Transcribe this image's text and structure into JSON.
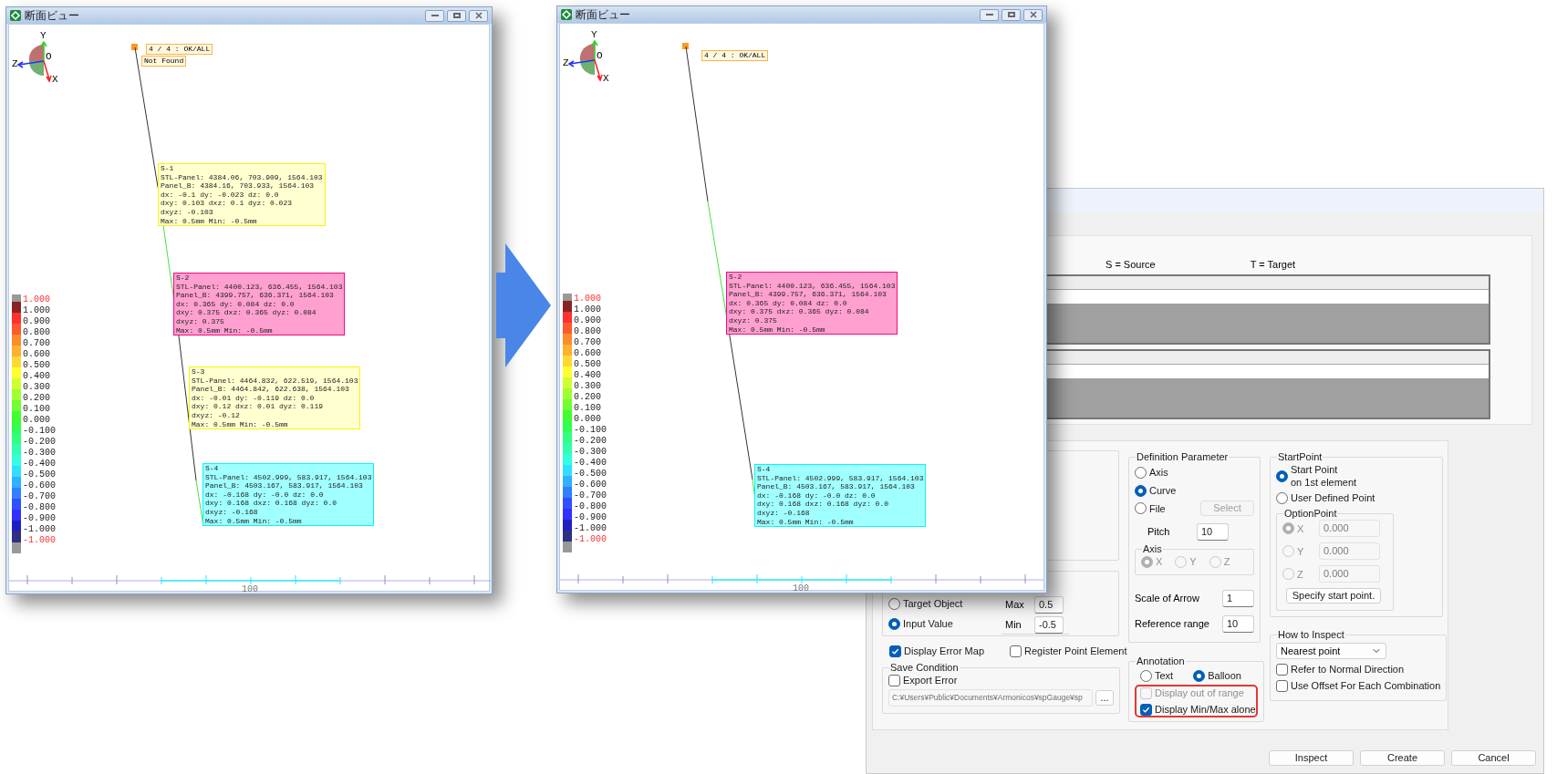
{
  "windows": [
    {
      "title": "断面ビュー",
      "axes": {
        "y": "Y",
        "z": "Z",
        "origin": "O",
        "x": "X"
      },
      "summary": "4 / 4 : OK/ALL",
      "notes": [
        "Not Found"
      ],
      "balloons": [
        {
          "color": "#ffffd0",
          "lines": [
            "S-1",
            "STL-Panel: 4384.06, 703.909, 1564.103",
            "Panel_B: 4384.16, 703.933, 1564.103",
            "dx: -0.1 dy: -0.023 dz: 0.0",
            "dxy: 0.103 dxz: 0.1 dyz: 0.023",
            "dxyz: -0.103",
            "Max: 0.5mm Min: -0.5mm"
          ]
        },
        {
          "color": "#ffa0d0",
          "lines": [
            "S-2",
            "STL-Panel: 4400.123, 636.455, 1564.103",
            "Panel_B: 4399.757, 636.371, 1564.103",
            "dx: 0.365 dy: 0.084 dz: 0.0",
            "dxy: 0.375 dxz: 0.365 dyz: 0.084",
            "dxyz: 0.375",
            "Max: 0.5mm Min: -0.5mm"
          ]
        },
        {
          "color": "#ffffd0",
          "lines": [
            "S-3",
            "STL-Panel: 4464.832, 622.519, 1564.103",
            "Panel_B: 4464.842, 622.638, 1564.103",
            "dx: -0.01 dy: -0.119 dz: 0.0",
            "dxy: 0.12 dxz: 0.01 dyz: 0.119",
            "dxyz: -0.12",
            "Max: 0.5mm Min: -0.5mm"
          ]
        },
        {
          "color": "#a0ffff",
          "lines": [
            "S-4",
            "STL-Panel: 4502.999, 583.917, 1564.103",
            "Panel_B: 4503.167, 583.917, 1564.103",
            "dx: -0.168 dy: -0.0 dz: 0.0",
            "dxy: 0.168 dxz: 0.168 dyz: 0.0",
            "dxyz: -0.168",
            "Max: 0.5mm Min: -0.5mm"
          ]
        }
      ],
      "legend": [
        {
          "value": "1.000",
          "kind": "limit"
        },
        {
          "value": "1.000",
          "kind": "step"
        },
        {
          "value": "0.900",
          "kind": "step"
        },
        {
          "value": "0.800",
          "kind": "step"
        },
        {
          "value": "0.700",
          "kind": "step"
        },
        {
          "value": "0.600",
          "kind": "step"
        },
        {
          "value": "0.500",
          "kind": "step"
        },
        {
          "value": "0.400",
          "kind": "step"
        },
        {
          "value": "0.300",
          "kind": "step"
        },
        {
          "value": "0.200",
          "kind": "step"
        },
        {
          "value": "0.100",
          "kind": "step"
        },
        {
          "value": "0.000",
          "kind": "step"
        },
        {
          "value": "-0.100",
          "kind": "step"
        },
        {
          "value": "-0.200",
          "kind": "step"
        },
        {
          "value": "-0.300",
          "kind": "step"
        },
        {
          "value": "-0.400",
          "kind": "step"
        },
        {
          "value": "-0.500",
          "kind": "step"
        },
        {
          "value": "-0.600",
          "kind": "step"
        },
        {
          "value": "-0.700",
          "kind": "step"
        },
        {
          "value": "-0.800",
          "kind": "step"
        },
        {
          "value": "-0.900",
          "kind": "step"
        },
        {
          "value": "-1.000",
          "kind": "step"
        },
        {
          "value": "-1.000",
          "kind": "limit"
        }
      ],
      "ruler_label": "100"
    },
    {
      "title": "断面ビュー",
      "axes": {
        "y": "Y",
        "z": "Z",
        "origin": "O",
        "x": "X"
      },
      "summary": "4 / 4 : OK/ALL",
      "balloons": [
        {
          "color": "#ffa0d0",
          "lines": [
            "S-2",
            "STL-Panel: 4400.123, 636.455, 1564.103",
            "Panel_B: 4399.757, 636.371, 1564.103",
            "dx: 0.365 dy: 0.084 dz: 0.0",
            "dxy: 0.375 dxz: 0.365 dyz: 0.084",
            "dxyz: 0.375",
            "Max: 0.5mm Min: -0.5mm"
          ]
        },
        {
          "color": "#a0ffff",
          "lines": [
            "S-4",
            "STL-Panel: 4502.999, 583.917, 1564.103",
            "Panel_B: 4503.167, 583.917, 1564.103",
            "dx: -0.168 dy: -0.0 dz: 0.0",
            "dxy: 0.168 dxz: 0.168 dyz: 0.0",
            "dxyz: -0.168",
            "Max: 0.5mm Min: -0.5mm"
          ]
        }
      ],
      "legend": [
        {
          "value": "1.000",
          "kind": "limit"
        },
        {
          "value": "1.000",
          "kind": "step"
        },
        {
          "value": "0.900",
          "kind": "step"
        },
        {
          "value": "0.800",
          "kind": "step"
        },
        {
          "value": "0.700",
          "kind": "step"
        },
        {
          "value": "0.600",
          "kind": "step"
        },
        {
          "value": "0.500",
          "kind": "step"
        },
        {
          "value": "0.400",
          "kind": "step"
        },
        {
          "value": "0.300",
          "kind": "step"
        },
        {
          "value": "0.200",
          "kind": "step"
        },
        {
          "value": "0.100",
          "kind": "step"
        },
        {
          "value": "0.000",
          "kind": "step"
        },
        {
          "value": "-0.100",
          "kind": "step"
        },
        {
          "value": "-0.200",
          "kind": "step"
        },
        {
          "value": "-0.300",
          "kind": "step"
        },
        {
          "value": "-0.400",
          "kind": "step"
        },
        {
          "value": "-0.500",
          "kind": "step"
        },
        {
          "value": "-0.600",
          "kind": "step"
        },
        {
          "value": "-0.700",
          "kind": "step"
        },
        {
          "value": "-0.800",
          "kind": "step"
        },
        {
          "value": "-0.900",
          "kind": "step"
        },
        {
          "value": "-1.000",
          "kind": "step"
        },
        {
          "value": "-1.000",
          "kind": "limit"
        }
      ],
      "ruler_label": "100"
    }
  ],
  "dialog": {
    "source_label": "S = Source",
    "target_label": "T = Target",
    "limits": {
      "options": [
        {
          "label": "Target Object",
          "selected": false
        },
        {
          "label": "Input Value",
          "selected": true
        }
      ],
      "max": {
        "label": "Max",
        "value": "0.5"
      },
      "min": {
        "label": "Min",
        "value": "-0.5"
      }
    },
    "display_error_map": {
      "label": "Display Error Map",
      "checked": true
    },
    "register_point_element": {
      "label": "Register Point Element",
      "checked": false
    },
    "save_condition": {
      "title": "Save Condition",
      "export_error": {
        "label": "Export Error",
        "checked": false
      },
      "path": {
        "value": "C:¥Users¥Public¥Documents¥Armonicos¥spGauge¥sp",
        "disabled": true
      },
      "browse_button": "..."
    },
    "definition_parameter": {
      "title": "Definition Parameter",
      "options": [
        {
          "label": "Axis",
          "selected": false
        },
        {
          "label": "Curve",
          "selected": true
        },
        {
          "label": "File",
          "selected": false
        }
      ],
      "select_button": {
        "label": "Select",
        "disabled": true
      },
      "pitch": {
        "label": "Pitch",
        "value": "10"
      },
      "axis": {
        "title": "Axis",
        "disabled": true,
        "options": [
          {
            "label": "X",
            "selected": true
          },
          {
            "label": "Y",
            "selected": false
          },
          {
            "label": "Z",
            "selected": false
          }
        ]
      },
      "scale_of_arrow": {
        "label": "Scale of Arrow",
        "value": "1"
      },
      "reference_range": {
        "label": "Reference range",
        "value": "10"
      }
    },
    "annotation": {
      "title": "Annotation",
      "options": [
        {
          "label": "Text",
          "selected": false
        },
        {
          "label": "Balloon",
          "selected": true
        }
      ],
      "highlighted": true,
      "checks": [
        {
          "label": "Display out of range",
          "checked": false,
          "disabled": true
        },
        {
          "label": "Display Min/Max alone",
          "checked": true,
          "disabled": false
        }
      ]
    },
    "start_point": {
      "title": "StartPoint",
      "options": [
        {
          "label": "Start Point\non 1st element",
          "selected": true
        },
        {
          "label": "User Defined Point",
          "selected": false
        }
      ],
      "option_point": {
        "title": "OptionPoint",
        "disabled": true,
        "coords": [
          {
            "label": "X",
            "selected": true,
            "value": "0.000"
          },
          {
            "label": "Y",
            "selected": false,
            "value": "0.000"
          },
          {
            "label": "Z",
            "selected": false,
            "value": "0.000"
          }
        ]
      },
      "specify_button": "Specify start point."
    },
    "how_to_inspect": {
      "title": "How to Inspect",
      "method": "Nearest point",
      "checks": [
        {
          "label": "Refer to Normal Direction",
          "checked": false
        },
        {
          "label": "Use Offset For Each Combination",
          "checked": false
        }
      ]
    },
    "buttons": [
      "Inspect",
      "Create",
      "Cancel"
    ]
  }
}
